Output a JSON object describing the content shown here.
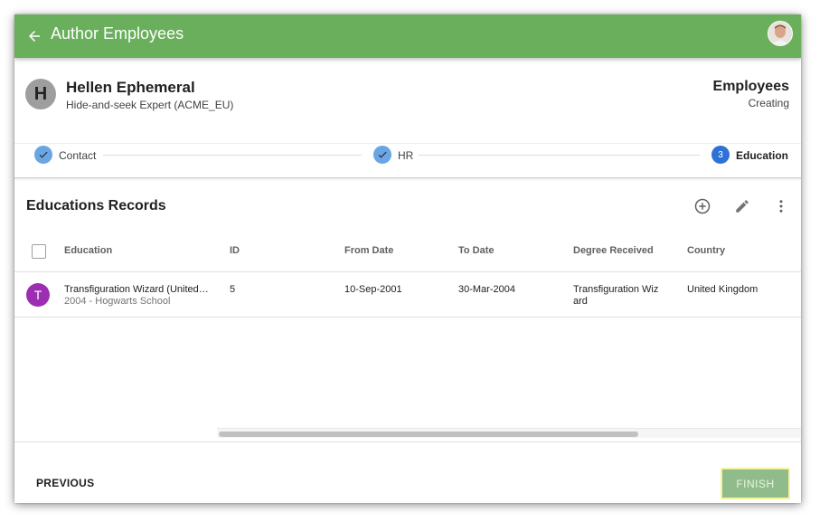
{
  "appbar": {
    "title": "Author Employees",
    "back_icon": "arrow-left-icon",
    "color": "#6aaf5c"
  },
  "header": {
    "avatar_letter": "H",
    "name": "Hellen Ephemeral",
    "role": "Hide-and-seek Expert (ACME_EU)",
    "entity": "Employees",
    "status": "Creating"
  },
  "stepper": {
    "steps": [
      {
        "label": "Contact",
        "state": "done"
      },
      {
        "label": "HR",
        "state": "done"
      },
      {
        "label": "Education",
        "state": "active",
        "number": "3"
      }
    ]
  },
  "section": {
    "title": "Educations Records",
    "actions": [
      "add-circle-icon",
      "edit-pencil-icon",
      "more-vert-icon"
    ]
  },
  "table": {
    "columns": [
      "Education",
      "ID",
      "From Date",
      "To Date",
      "Degree Received",
      "Country"
    ],
    "rows": [
      {
        "avatar": "T",
        "education": "Transfiguration Wizard (United Kingdom)",
        "education_sub": "2004 - Hogwarts School",
        "id": "5",
        "from": "10-Sep-2001",
        "to": "30-Mar-2004",
        "degree": "Transfiguration Wizard",
        "country": "United Kingdom"
      }
    ]
  },
  "footer": {
    "previous": "PREVIOUS",
    "finish": "FINISH"
  }
}
